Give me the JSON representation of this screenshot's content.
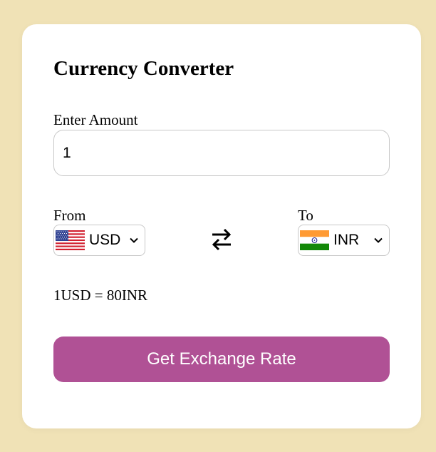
{
  "title": "Currency Converter",
  "amount": {
    "label": "Enter Amount",
    "value": "1"
  },
  "from": {
    "label": "From",
    "selected": "USD",
    "flag_icon": "us-flag-icon"
  },
  "to": {
    "label": "To",
    "selected": "INR",
    "flag_icon": "india-flag-icon"
  },
  "swap_icon": "swap-arrows-icon",
  "rate_text": "1USD = 80INR",
  "button_label": "Get Exchange Rate",
  "colors": {
    "background": "#f0e2b6",
    "card": "#ffffff",
    "button": "#b05195",
    "button_text": "#ffffff"
  }
}
